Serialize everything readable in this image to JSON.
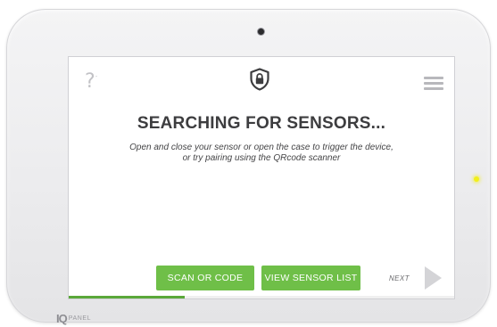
{
  "device": {
    "brand_mark": "IQ",
    "brand_text": "PANEL",
    "led_color": "#f2ef1a"
  },
  "screen": {
    "help_icon": "question-icon",
    "menu_icon": "hamburger-menu-icon",
    "status_icon": "shield-lock-icon",
    "title": "SEARCHING FOR SENSORS...",
    "instructions": {
      "line1": "Open and close your sensor or open the case to trigger the device,",
      "line2": "or try pairing using the QRcode scanner"
    },
    "buttons": {
      "scan_label": "SCAN OR CODE",
      "list_label": "VIEW SENSOR LIST",
      "color": "#6fbf48"
    },
    "next": {
      "label": "NEXT",
      "icon": "play-arrow-icon"
    },
    "progress": {
      "percent": 30,
      "color": "#5aa83a"
    }
  }
}
